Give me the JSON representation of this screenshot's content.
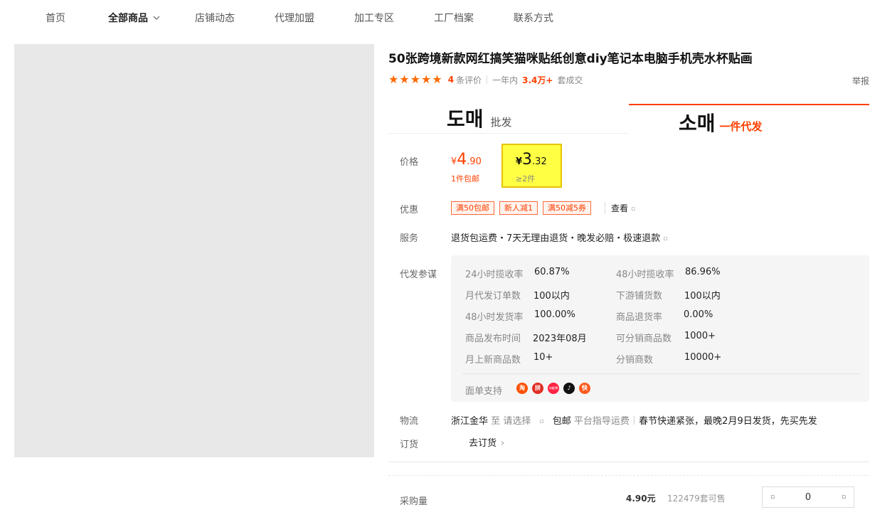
{
  "nav": {
    "items": [
      "首页",
      "全部商品",
      "店铺动态",
      "代理加盟",
      "加工专区",
      "工厂档案",
      "联系方式"
    ]
  },
  "product": {
    "title": "50张跨境新款网红搞笑猫咪贴纸创意diy笔记本电脑手机壳水杯贴画",
    "rating_stars": 5,
    "review_count": "4",
    "review_suffix": "条评价",
    "period_label": "一年内",
    "deal_count": "3.4万+",
    "deal_suffix": "套成交",
    "report_label": "举报"
  },
  "tabs": {
    "wholesale_kr": "도매",
    "wholesale_cn": "批发",
    "dropship_kr": "소매",
    "dropship_cn": "一件代发"
  },
  "price": {
    "label": "价格",
    "tier1": {
      "yen": "¥",
      "int": "4",
      "dec": ".90",
      "note": "1件包邮"
    },
    "tier2": {
      "yen": "¥",
      "int": "3",
      "dec": ".32",
      "note": "≥2件"
    }
  },
  "promo": {
    "label": "优惠",
    "coupons": [
      "满50包邮",
      "新人减1",
      "满50减5券"
    ],
    "view_label": "查看"
  },
  "service": {
    "label": "服务",
    "text": "退货包运费・7天无理由退货・晚发必赔・极速退款"
  },
  "dropship_stats": {
    "label": "代发参谋",
    "items": [
      {
        "k": "24小时揽收率",
        "v": "60.87%"
      },
      {
        "k": "48小时揽收率",
        "v": "86.96%"
      },
      {
        "k": "月代发订单数",
        "v": "100以内"
      },
      {
        "k": "下游铺货数",
        "v": "100以内"
      },
      {
        "k": "48小时发货率",
        "v": "100.00%"
      },
      {
        "k": "商品退货率",
        "v": "0.00%"
      },
      {
        "k": "商品发布时间",
        "v": "2023年08月"
      },
      {
        "k": "可分销商品数",
        "v": "1000+"
      },
      {
        "k": "月上新商品数",
        "v": "10+"
      },
      {
        "k": "分销商数",
        "v": "10000+"
      }
    ],
    "waybill_label": "面单支持",
    "platforms": [
      {
        "name": "taobao-icon",
        "glyph": "淘",
        "color": "#ff5000"
      },
      {
        "name": "pinduoduo-icon",
        "glyph": "拼",
        "color": "#e02e24"
      },
      {
        "name": "xiaohongshu-icon",
        "glyph": "小红书",
        "color": "#ff2442"
      },
      {
        "name": "douyin-icon",
        "glyph": "♪",
        "color": "#111111"
      },
      {
        "name": "kuaishou-icon",
        "glyph": "快",
        "color": "#ff5a1f"
      }
    ]
  },
  "logistics": {
    "label": "物流",
    "origin": "浙江金华",
    "to": "至",
    "dest": "请选择",
    "shipping": "包邮",
    "guide": "平台指导运费",
    "notice": "春节快递紧张，最晚2月9日发货，先买先发"
  },
  "order": {
    "label": "订货",
    "link": "去订货"
  },
  "purchase": {
    "label": "采购量",
    "unit_price": "4.90元",
    "stock": "122479套可售",
    "qty": "0"
  },
  "colors": {
    "accent": "#ff4000",
    "highlight": "#ffff44"
  }
}
